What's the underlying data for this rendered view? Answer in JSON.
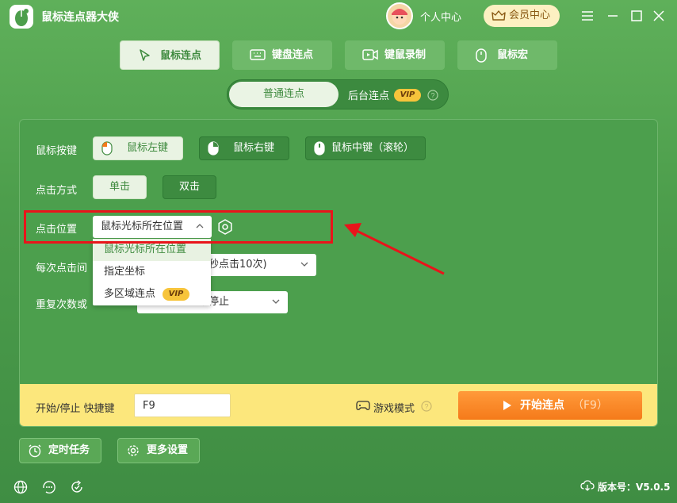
{
  "app": {
    "title": "鼠标连点器大侠",
    "user_center": "个人中心",
    "vip_center": "会员中心"
  },
  "main_tabs": [
    {
      "label": "鼠标连点",
      "active": true
    },
    {
      "label": "键盘连点",
      "active": false
    },
    {
      "label": "键鼠录制",
      "active": false
    },
    {
      "label": "鼠标宏",
      "active": false
    }
  ],
  "sub_toggle": {
    "normal": "普通连点",
    "background": "后台连点",
    "vip": "VIP"
  },
  "settings": {
    "mouse_button": {
      "label": "鼠标按键",
      "options": [
        "鼠标左键",
        "鼠标右键",
        "鼠标中键（滚轮）"
      ],
      "selected": "鼠标左键"
    },
    "click_mode": {
      "label": "点击方式",
      "options": [
        "单击",
        "双击"
      ],
      "selected": "单击"
    },
    "click_position": {
      "label": "点击位置",
      "value": "鼠标光标所在位置",
      "options": [
        "鼠标光标所在位置",
        "指定坐标",
        "多区域连点"
      ],
      "vip_option": "VIP"
    },
    "interval": {
      "label": "每次点击间",
      "value": "秒点击10次)"
    },
    "repeat": {
      "label": "重复次数或",
      "value": "手动停止"
    }
  },
  "hotkey_bar": {
    "label": "开始/停止 快捷键",
    "hotkey": "F9",
    "game_mode": "游戏模式",
    "start_label": "开始连点",
    "start_hotkey": "（F9）"
  },
  "bottom": {
    "timer": "定时任务",
    "more": "更多设置",
    "version": "版本号：V5.0.5"
  },
  "colors": {
    "bg_green": "#4d9e4c",
    "accent_orange": "#f57a1a",
    "highlight_red": "#e9141b",
    "vip_gold": "#f7c43b",
    "hotkey_yellow": "#fce77c"
  }
}
